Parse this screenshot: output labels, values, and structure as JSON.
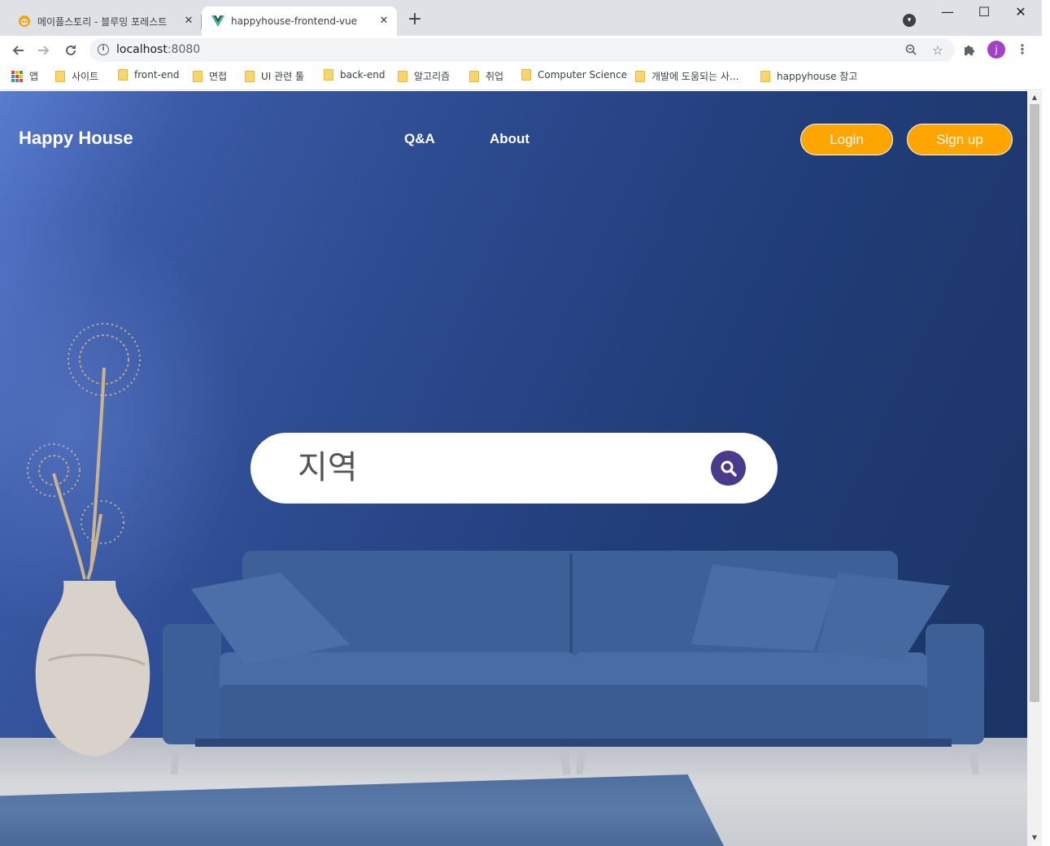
{
  "browser": {
    "tabs": [
      {
        "title": "메이플스토리 - 블루밍 포레스트",
        "active": false,
        "icon": "maple-mushroom-icon"
      },
      {
        "title": "happyhouse-frontend-vue",
        "active": true,
        "icon": "vue-logo-icon"
      }
    ],
    "close_glyph": "✕",
    "new_tab_glyph": "+",
    "window_controls": {
      "minimize": "—",
      "maximize": "☐",
      "close": "✕"
    },
    "url_host": "localhost",
    "url_port": ":8080",
    "profile_initial": "j",
    "bookmarks": [
      {
        "label": "앱",
        "type": "apps"
      },
      {
        "label": "사이트",
        "type": "folder"
      },
      {
        "label": "front-end",
        "type": "folder"
      },
      {
        "label": "면접",
        "type": "folder"
      },
      {
        "label": "UI 관련 툴",
        "type": "folder"
      },
      {
        "label": "back-end",
        "type": "folder"
      },
      {
        "label": "알고리즘",
        "type": "folder"
      },
      {
        "label": "취업",
        "type": "folder"
      },
      {
        "label": "Computer Science",
        "type": "folder"
      },
      {
        "label": "개발에 도움되는 사...",
        "type": "folder"
      },
      {
        "label": "happyhouse 참고",
        "type": "folder"
      }
    ]
  },
  "site": {
    "logo": "Happy House",
    "nav": {
      "qna": "Q&A",
      "about": "About"
    },
    "buttons": {
      "login": "Login",
      "signup": "Sign up"
    },
    "search": {
      "placeholder": "지역"
    },
    "colors": {
      "accent": "#ffa500",
      "search_button": "#4a3a8c",
      "background": "#2c4a8f"
    }
  }
}
